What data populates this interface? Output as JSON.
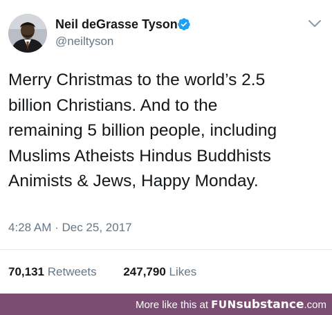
{
  "tweet": {
    "display_name": "Neil deGrasse Tyson",
    "handle": "@neiltyson",
    "text": "Merry Christmas to the world’s 2.5\nbillion Christians. And to the\nremaining 5 billion people, including\nMuslims Atheists  Hindus Buddhists\nAnimists & Jews, Happy Monday.",
    "timestamp": "4:28 AM · Dec 25, 2017",
    "retweets_count": "70,131",
    "retweets_label": "Retweets",
    "likes_count": "247,790",
    "likes_label": "Likes",
    "verified_color": "#1da1f2"
  },
  "footer": {
    "prefix": "More like this at",
    "brand_bold": "FUN",
    "brand_rest": "substance",
    "brand_suffix": ".com",
    "background": "#7c4d72"
  },
  "icons": {
    "avatar": "profile-photo",
    "verified": "verified-badge-icon",
    "menu": "chevron-down-icon"
  }
}
